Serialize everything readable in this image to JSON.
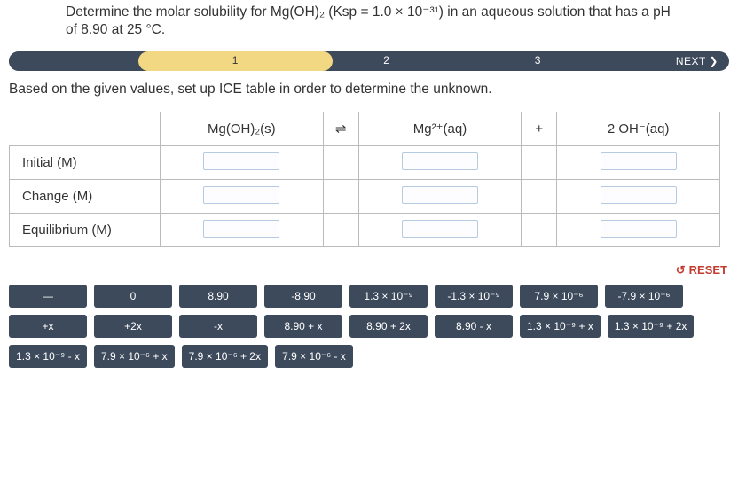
{
  "question": "Determine the molar solubility for Mg(OH)₂ (Ksp = 1.0 × 10⁻³¹) in an aqueous solution that has a pH of 8.90 at 25 °C.",
  "progress": {
    "step1": "1",
    "step2": "2",
    "step3": "3",
    "next": "NEXT  ❯"
  },
  "instruction": "Based on the given values, set up ICE table in order to determine the unknown.",
  "ice_headers": {
    "col1": "Mg(OH)₂(s)",
    "eq": "⇌",
    "col2": "Mg²⁺(aq)",
    "plus": "+",
    "col3": "2 OH⁻(aq)"
  },
  "ice_rows": {
    "r1": "Initial (M)",
    "r2": "Change (M)",
    "r3": "Equilibrium (M)"
  },
  "reset": "RESET",
  "tiles": [
    "—",
    "0",
    "8.90",
    "-8.90",
    "1.3 × 10⁻⁹",
    "-1.3 × 10⁻⁹",
    "7.9 × 10⁻⁶",
    "-7.9 × 10⁻⁶",
    "+x",
    "+2x",
    "-x",
    "8.90 + x",
    "8.90 + 2x",
    "8.90 - x",
    "1.3 × 10⁻⁹ + x",
    "1.3 × 10⁻⁹ + 2x",
    "1.3 × 10⁻⁹ - x",
    "7.9 × 10⁻⁶ + x",
    "7.9 × 10⁻⁶ + 2x",
    "7.9 × 10⁻⁶ - x"
  ]
}
